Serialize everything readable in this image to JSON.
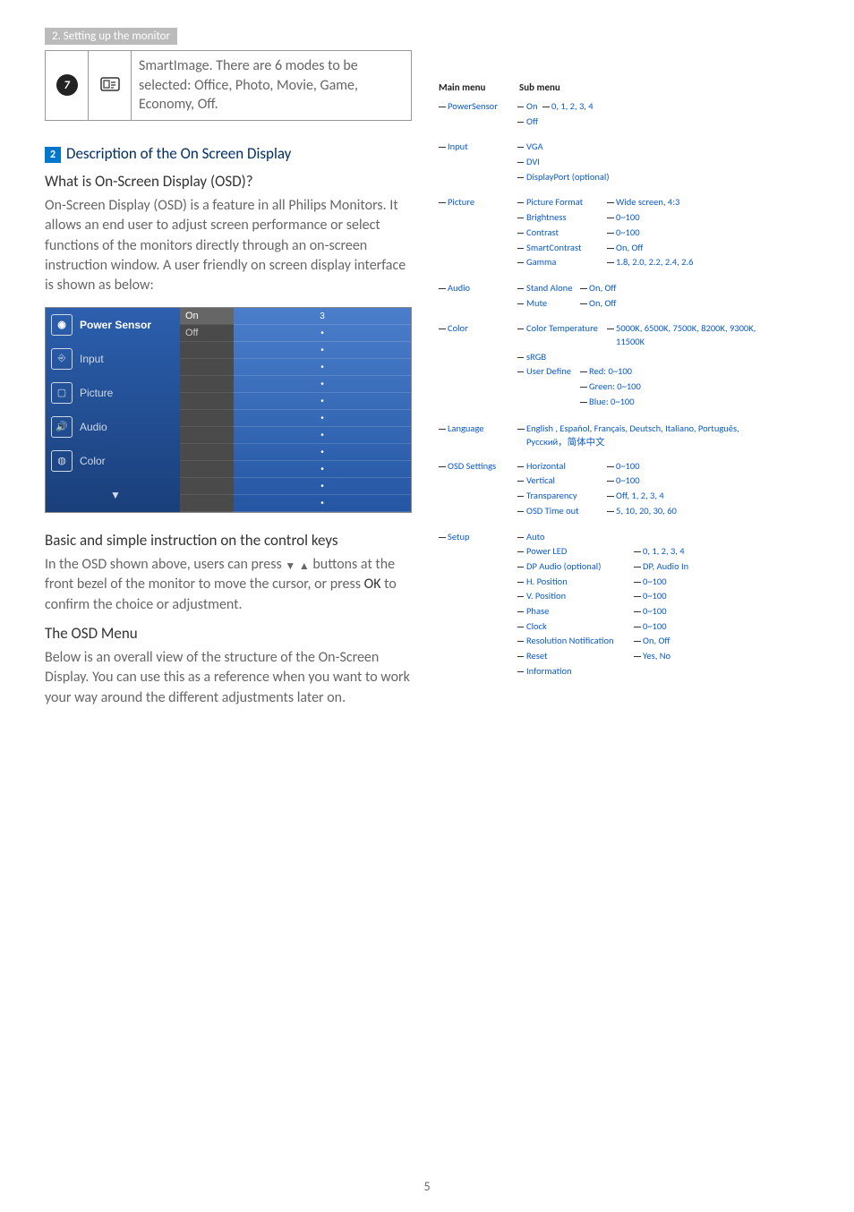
{
  "section_chip": "2. Setting up the monitor",
  "step7": {
    "num": "7",
    "icon_name": "smartimage-icon",
    "text": "SmartImage. There are 6 modes to be selected: Office, Photo, Movie, Game, Economy, Off."
  },
  "heading2_num": "2",
  "heading2": "Description of the On Screen Display",
  "q_heading": "What is On-Screen Display (OSD)?",
  "para1": "On-Screen Display (OSD) is a feature in all Philips Monitors. It allows an end user to adjust screen performance or select functions of the monitors directly through an on-screen instruction window. A user friendly on screen display interface is shown as below:",
  "osd_preview": {
    "items": [
      "Power Sensor",
      "Input",
      "Picture",
      "Audio",
      "Color"
    ],
    "mid": [
      "On",
      "Off"
    ],
    "right_first": "3"
  },
  "keys_heading": "Basic and simple instruction on the control keys",
  "keys_para_a": "In the OSD shown above, users can press ",
  "keys_para_b": " buttons at the front bezel of the monitor to move the cursor, or press ",
  "keys_ok": "OK",
  "keys_para_c": " to confirm the choice or adjustment.",
  "menu_heading": "The OSD Menu",
  "menu_para": "Below is an overall view of the structure of the On-Screen Display. You can use this as a reference when you want to work your way around the different adjustments later on.",
  "tree_header_main": "Main menu",
  "tree_header_sub": "Sub menu",
  "tree": {
    "powersensor": {
      "label": "PowerSensor",
      "subs": [
        {
          "label": "On",
          "vals": "0, 1, 2, 3, 4"
        },
        {
          "label": "Off"
        }
      ]
    },
    "input": {
      "label": "Input",
      "subs": [
        {
          "label": "VGA"
        },
        {
          "label": "DVI"
        },
        {
          "label": "DisplayPort (optional)"
        }
      ]
    },
    "picture": {
      "label": "Picture",
      "subs": [
        {
          "label": "Picture Format",
          "vals": "Wide screen, 4:3"
        },
        {
          "label": "Brightness",
          "vals": "0~100"
        },
        {
          "label": "Contrast",
          "vals": "0~100"
        },
        {
          "label": "SmartContrast",
          "vals": "On, Off"
        },
        {
          "label": "Gamma",
          "vals": "1.8, 2.0, 2.2, 2.4, 2.6"
        }
      ]
    },
    "audio": {
      "label": "Audio",
      "subs": [
        {
          "label": "Stand Alone",
          "vals": "On, Off"
        },
        {
          "label": "Mute",
          "vals": "On, Off"
        }
      ]
    },
    "color": {
      "label": "Color",
      "ct": {
        "label": "Color Temperature",
        "vals": "5000K, 6500K, 7500K, 8200K, 9300K, 11500K"
      },
      "srgb": "sRGB",
      "ud": {
        "label": "User Define",
        "r": "Red: 0~100",
        "g": "Green: 0~100",
        "b": "Blue: 0~100"
      }
    },
    "language": {
      "label": "Language",
      "vals": "English , Español, Français, Deutsch, Italiano, Português, Русский，简体中文"
    },
    "osdset": {
      "label": "OSD Settings",
      "subs": [
        {
          "label": "Horizontal",
          "vals": "0~100"
        },
        {
          "label": "Vertical",
          "vals": "0~100"
        },
        {
          "label": "Transparency",
          "vals": "Off, 1, 2, 3, 4"
        },
        {
          "label": "OSD Time out",
          "vals": "5, 10, 20, 30, 60"
        }
      ]
    },
    "setup": {
      "label": "Setup",
      "subs": [
        {
          "label": "Auto"
        },
        {
          "label": "Power LED",
          "vals": "0, 1, 2, 3, 4"
        },
        {
          "label": "DP Audio (optional)",
          "vals": "DP, Audio In"
        },
        {
          "label": "H. Position",
          "vals": "0~100"
        },
        {
          "label": "V. Position",
          "vals": "0~100"
        },
        {
          "label": "Phase",
          "vals": "0~100"
        },
        {
          "label": "Clock",
          "vals": "0~100"
        },
        {
          "label": "Resolution Notification",
          "vals": "On, Off"
        },
        {
          "label": "Reset",
          "vals": "Yes, No"
        },
        {
          "label": "Information"
        }
      ]
    }
  },
  "page_num": "5"
}
